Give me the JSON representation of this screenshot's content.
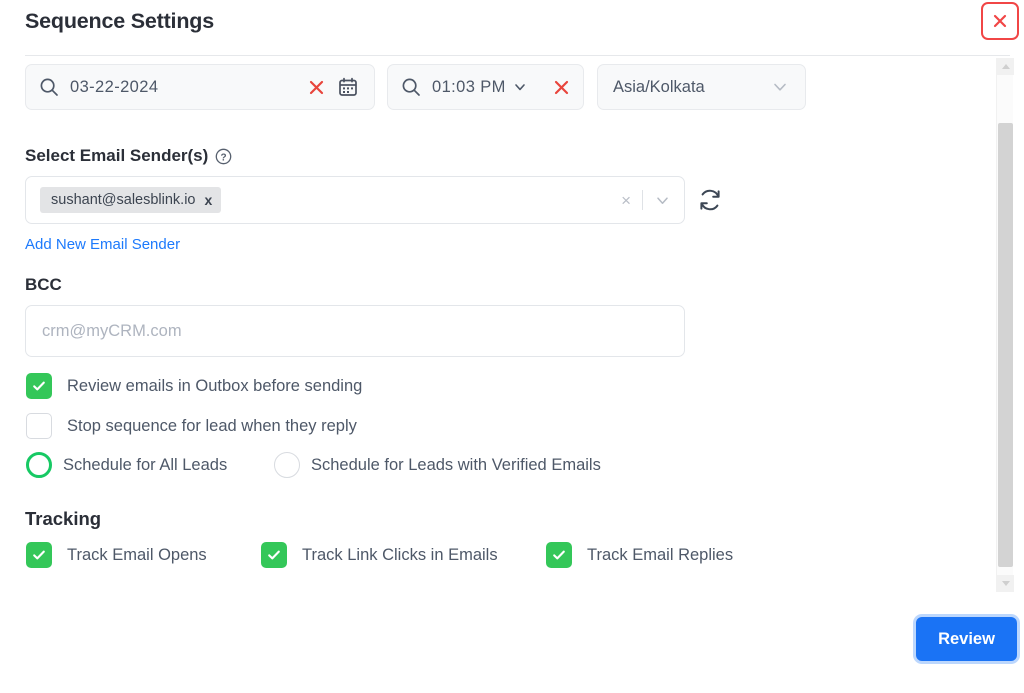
{
  "header": {
    "title": "Sequence Settings",
    "close_icon": "close-icon"
  },
  "schedule": {
    "date": {
      "value": "03-22-2024",
      "search_icon": "search-icon",
      "clear_icon": "clear-icon",
      "calendar_icon": "calendar-icon"
    },
    "time": {
      "value": "01:03  PM",
      "search_icon": "search-icon",
      "chevron_icon": "chevron-down-icon",
      "clear_icon": "clear-icon"
    },
    "timezone": {
      "value": "Asia/Kolkata",
      "chevron_icon": "chevron-down-icon"
    }
  },
  "sender": {
    "label": "Select Email Sender(s)",
    "help_icon": "help-circle-icon",
    "chips": [
      {
        "email": "sushant@salesblink.io",
        "remove": "x"
      }
    ],
    "clear_glyph": "×",
    "chevron_icon": "chevron-down-icon",
    "refresh_icon": "refresh-icon",
    "add_link": "Add New Email Sender"
  },
  "bcc": {
    "label": "BCC",
    "value": "",
    "placeholder": "crm@myCRM.com"
  },
  "options": {
    "checkboxes": [
      {
        "label": "Review emails in Outbox before sending",
        "checked": true
      },
      {
        "label": "Stop sequence for lead when they reply",
        "checked": false
      }
    ],
    "radios": [
      {
        "label": "Schedule for All Leads",
        "selected": true
      },
      {
        "label": "Schedule for Leads with Verified Emails",
        "selected": false
      }
    ]
  },
  "tracking": {
    "title": "Tracking",
    "items": [
      {
        "label": "Track Email Opens",
        "checked": true
      },
      {
        "label": "Track Link Clicks in Emails",
        "checked": true
      },
      {
        "label": "Track Email Replies",
        "checked": true
      }
    ]
  },
  "footer": {
    "review_label": "Review"
  },
  "colors": {
    "accent_blue": "#1a73f5",
    "link_blue": "#1d7afc",
    "green": "#34c759",
    "radio_green": "#17c964",
    "danger_red": "#f14646",
    "text": "#4e5868"
  }
}
